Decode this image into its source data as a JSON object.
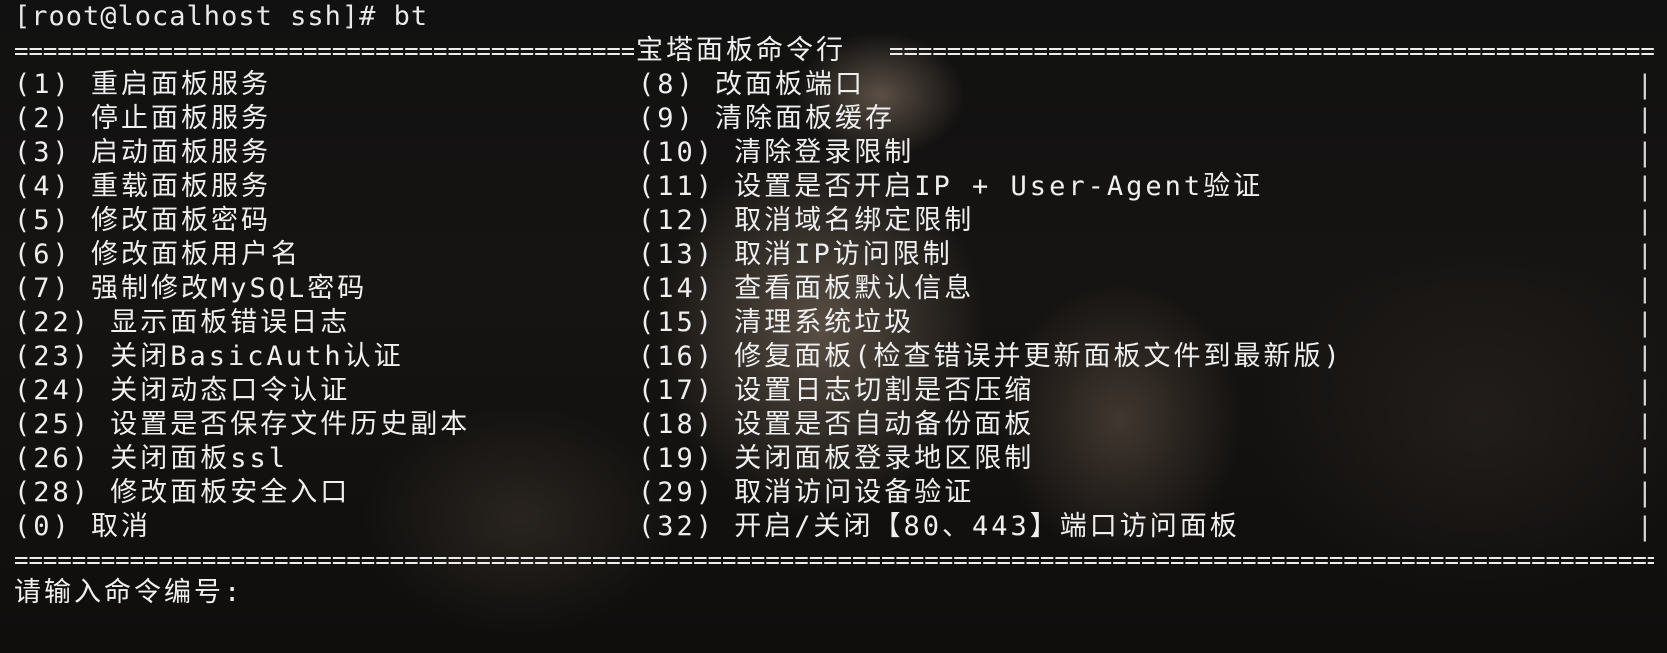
{
  "terminal": {
    "command_line": "[root@localhost ssh]# bt",
    "menu_title": "宝塔面板命令行",
    "rule_char": "================================================================================================================================================",
    "left_items": [
      "(1) 重启面板服务",
      "(2) 停止面板服务",
      "(3) 启动面板服务",
      "(4) 重载面板服务",
      "(5) 修改面板密码",
      "(6) 修改面板用户名",
      "(7) 强制修改MySQL密码",
      "(22) 显示面板错误日志",
      "(23) 关闭BasicAuth认证",
      "(24) 关闭动态口令认证",
      "(25) 设置是否保存文件历史副本",
      "(26) 关闭面板ssl",
      "(28) 修改面板安全入口",
      "(0) 取消"
    ],
    "right_items": [
      "(8) 改面板端口",
      "(9) 清除面板缓存",
      "(10) 清除登录限制",
      "(11) 设置是否开启IP + User-Agent验证",
      "(12) 取消域名绑定限制",
      "(13) 取消IP访问限制",
      "(14) 查看面板默认信息",
      "(15) 清理系统垃圾",
      "(16) 修复面板(检查错误并更新面板文件到最新版)",
      "(17) 设置日志切割是否压缩",
      "(18) 设置是否自动备份面板",
      "(19) 关闭面板登录地区限制",
      "(29) 取消访问设备验证",
      "(32) 开启/关闭【80、443】端口访问面板"
    ],
    "border_char": "|",
    "input_prompt": "请输入命令编号:"
  }
}
